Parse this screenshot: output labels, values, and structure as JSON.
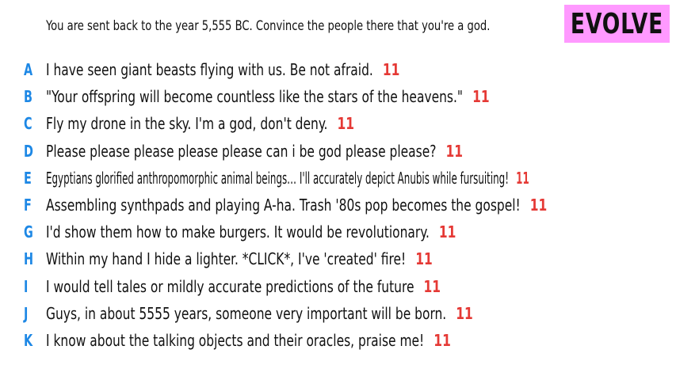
{
  "prompt": "You are sent back to the year 5,555 BC. Convince the people there that you're a god.",
  "badge": {
    "label": "EVOLVE",
    "background": "#ff99ff"
  },
  "colors": {
    "letter": "#1e88e5",
    "score": "#e53935",
    "text": "#111111"
  },
  "answers": [
    {
      "letter": "A",
      "text": "I have seen giant beasts flying with us. Be not afraid.",
      "score": "11"
    },
    {
      "letter": "B",
      "text": "\"Your offspring will become countless like the stars of the heavens.\"",
      "score": "11"
    },
    {
      "letter": "C",
      "text": "Fly my drone in the sky. I'm a god, don't deny.",
      "score": "11"
    },
    {
      "letter": "D",
      "text": "Please please please please please can i be god please please?",
      "score": "11"
    },
    {
      "letter": "E",
      "text": "Egyptians glorified anthropomorphic animal beings… I'll accurately depict Anubis while fursuiting!",
      "score": "11"
    },
    {
      "letter": "F",
      "text": "Assembling synthpads and playing A-ha. Trash '80s pop becomes the gospel!",
      "score": "11"
    },
    {
      "letter": "G",
      "text": "I'd show them how to make burgers. It would be revolutionary.",
      "score": "11"
    },
    {
      "letter": "H",
      "text": "Within my hand I hide a lighter. *CLICK*, I've 'created' fire!",
      "score": "11"
    },
    {
      "letter": "I",
      "text": "I would tell tales or mildly accurate predictions of the future",
      "score": "11"
    },
    {
      "letter": "J",
      "text": "Guys, in about 5555 years, someone very important will be born.",
      "score": "11"
    },
    {
      "letter": "K",
      "text": "I know about the talking objects and their oracles, praise me!",
      "score": "11"
    }
  ]
}
